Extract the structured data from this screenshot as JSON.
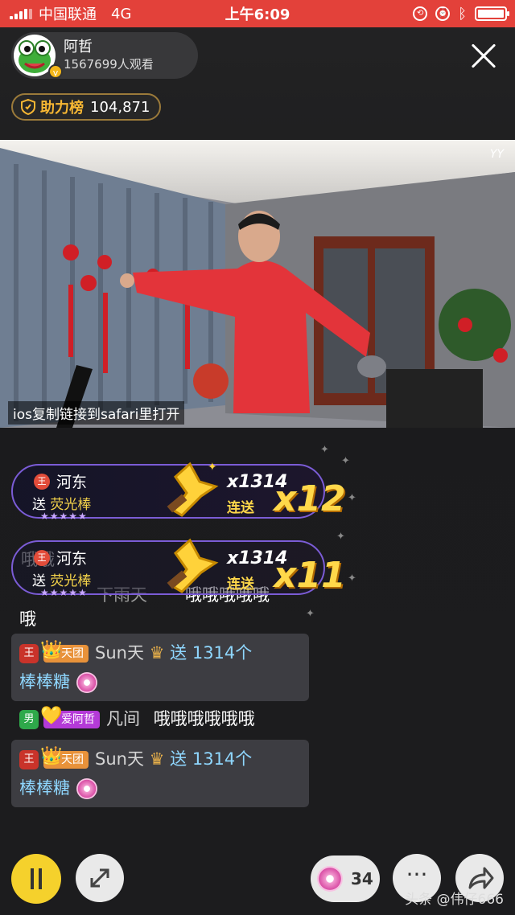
{
  "status_bar": {
    "carrier": "中国联通",
    "network": "4G",
    "time": "上午6:09"
  },
  "host": {
    "name": "阿哲",
    "viewers": "1567699人观看",
    "verified": "v"
  },
  "rank": {
    "label": "助力榜",
    "value": "104,871"
  },
  "video": {
    "logo": "YY",
    "caption": "ios复制链接到safari里打开"
  },
  "gift_banners": [
    {
      "level": "王",
      "user": "河东",
      "send": "送",
      "gift": "荧光棒",
      "multiplier": "x1314",
      "combo_label": "连送",
      "combo": "x12",
      "stars": "★★★★★"
    },
    {
      "level": "王",
      "user": "河东",
      "send": "送",
      "gift": "荧光棒",
      "multiplier": "x1314",
      "combo_label": "连送",
      "combo": "x11",
      "stars": "★★★★★"
    }
  ],
  "obscured_chat": {
    "line1": "哦哦",
    "line2": "下雨天",
    "line3": "哦哦哦哦哦",
    "line4": "哦"
  },
  "chat_messages": [
    {
      "level": "王",
      "badge": "天团",
      "user": "Sun天",
      "action": "送 1314个",
      "gift": "棒棒糖"
    },
    {
      "level": "男",
      "badge": "爱阿哲",
      "user": "凡间",
      "text": "哦哦哦哦哦哦"
    },
    {
      "level": "王",
      "badge": "天团",
      "user": "Sun天",
      "action": "送 1314个",
      "gift": "棒棒糖"
    }
  ],
  "bottom_bar": {
    "lollipop_count": "34",
    "more": "···"
  },
  "watermark": "头条 @伟仔666",
  "colors": {
    "status_bar": "#e3413a",
    "accent_yellow": "#f5d12c",
    "combo": "#ffd84a",
    "badge_gold": "#e8923a",
    "badge_purple": "#b43ad8"
  }
}
